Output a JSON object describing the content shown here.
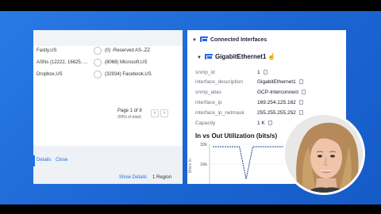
{
  "left_panel": {
    "as_rows": [
      {
        "left": "Fastly,US",
        "right": "(0) -Reserved AS-,ZZ"
      },
      {
        "left": "ASNs (12222, 16625, ...",
        "right": "(8068) Microsoft,US"
      },
      {
        "left": "Dropbox,US",
        "right": "(32934) Facebook,US"
      }
    ],
    "pagination": {
      "label": "Page 1 of 8",
      "sub": "(99% of total)",
      "prev": "‹",
      "next": "›"
    },
    "show_details": "Show Details",
    "region_count": "1 Region",
    "bottom_links": [
      "Details",
      "Close"
    ]
  },
  "right_panel": {
    "section_title": "Connected Interfaces",
    "interface_name": "GigabitEthernet1",
    "properties": [
      {
        "key": "snmp_id",
        "value": "1"
      },
      {
        "key": "interface_description",
        "value": "GigabitEthernet1"
      },
      {
        "key": "snmp_alias",
        "value": "GCP-Interconnect"
      },
      {
        "key": "interface_ip",
        "value": "169.254.125.162"
      },
      {
        "key": "interface_ip_netmask",
        "value": "255.255.255.252"
      },
      {
        "key": "Capacity",
        "value": "1 K"
      }
    ],
    "chart_title": "In vs Out Utilization (bits/s)"
  },
  "chart_data": {
    "type": "line",
    "title": "In vs Out Utilization (bits/s)",
    "ylabel": "Bits/s In",
    "yticks": [
      "32k",
      "16k"
    ],
    "ylim": [
      0,
      32000
    ],
    "series": [
      {
        "values": [
          30000,
          30000,
          30000,
          30000,
          30000,
          4000,
          30000,
          30000,
          30000,
          30000,
          30000,
          30000,
          30000,
          4000,
          30000,
          30000,
          30000,
          30000,
          30000,
          30000
        ]
      }
    ]
  },
  "colors": {
    "background": "#1d6ad6",
    "accent": "#1a73e8",
    "chart_line": "#1e3a8a"
  },
  "icons": {
    "section_icon": "interface-icon",
    "copy": "copy-icon"
  }
}
